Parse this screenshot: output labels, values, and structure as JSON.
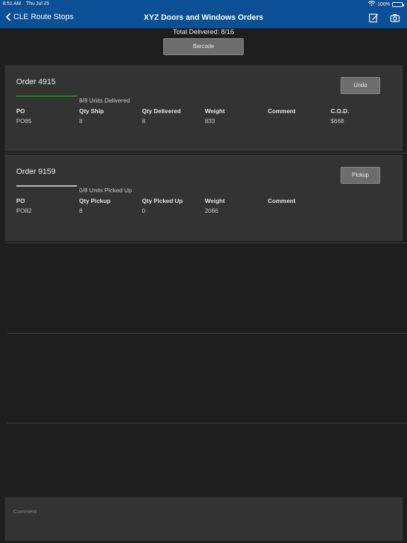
{
  "status_bar": {
    "time": "8:51 AM",
    "date": "Thu Jul 25",
    "battery": "100%"
  },
  "nav": {
    "back_label": "CLE Route Stops",
    "title": "XYZ Doors and Windows Orders",
    "icons": [
      "edit-icon",
      "camera-icon"
    ]
  },
  "total_delivered": "Total Delivered: 8/16",
  "barcode_label": "Barcode",
  "orders": [
    {
      "title": "Order 4915",
      "progress_text": "8/8 Units Delivered",
      "progress": 1.0,
      "progress_color": "#1e8a1e",
      "action_label": "Undo",
      "headers": [
        "PO",
        "Qty Ship",
        "Qty Delivered",
        "Weight",
        "Comment",
        "C.O.D."
      ],
      "values": [
        "PO85",
        "8",
        "8",
        "833",
        "",
        "$668"
      ]
    },
    {
      "title": "Order 9159",
      "progress_text": "0/8 Units Picked Up",
      "progress": 0.0,
      "progress_color": "#1e8a1e",
      "action_label": "Pickup",
      "headers": [
        "PO",
        "Qty Pickup",
        "Qty Picked Up",
        "Weight",
        "Comment"
      ],
      "values": [
        "PO82",
        "8",
        "0",
        "2066",
        ""
      ]
    }
  ],
  "comment_placeholder": "Comment",
  "colors": {
    "header": "#0b4f95",
    "background": "#1e1e1e",
    "card": "#333333"
  }
}
